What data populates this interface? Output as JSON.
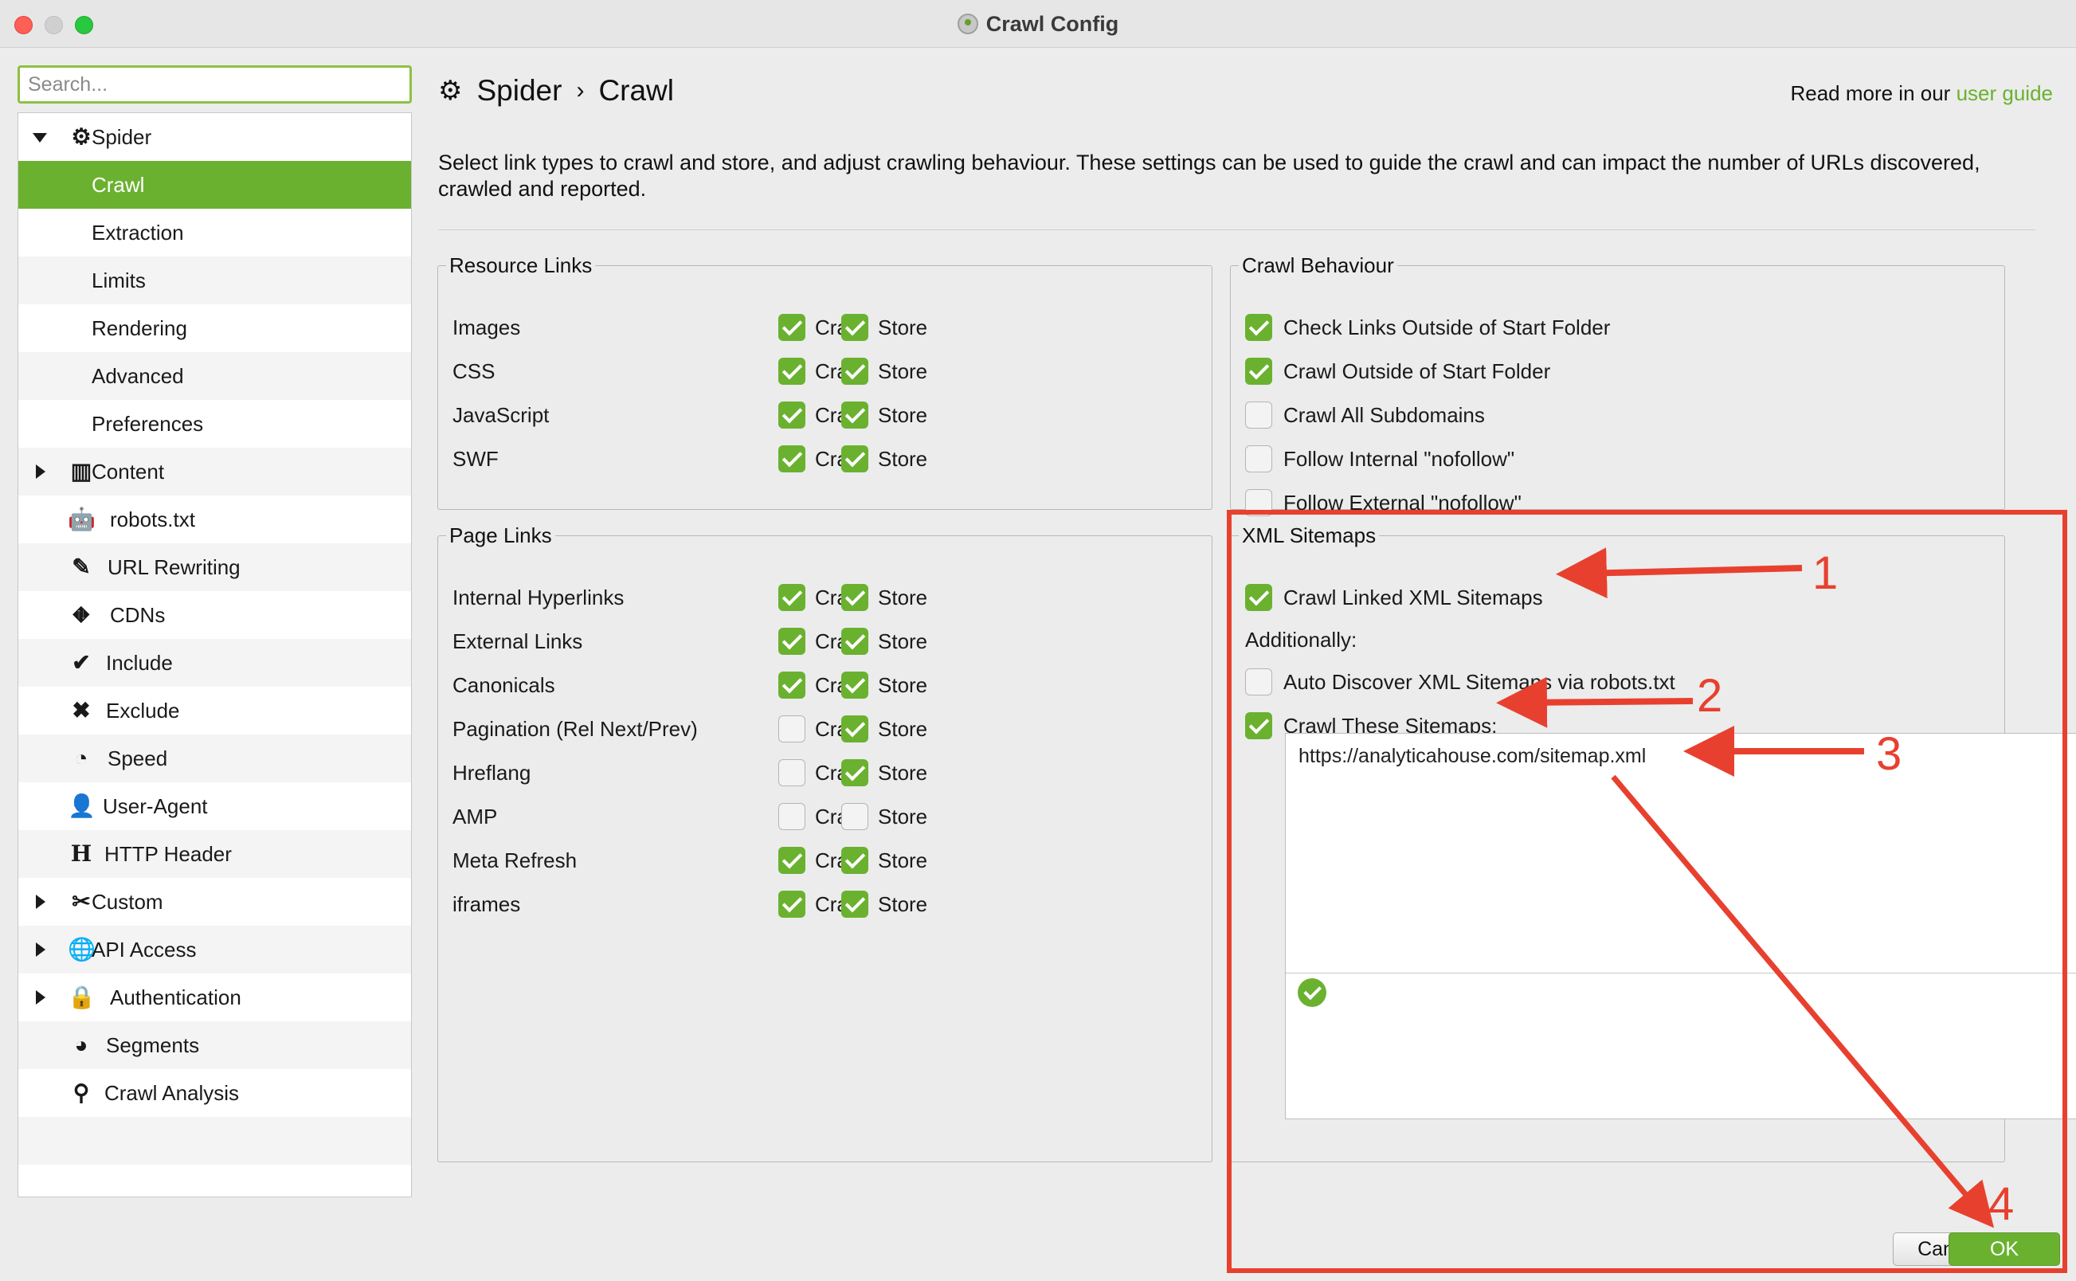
{
  "window": {
    "title": "Crawl Config"
  },
  "search": {
    "placeholder": "Search..."
  },
  "sidebar": {
    "items": [
      {
        "label": "Spider",
        "icon": "gear-icon"
      },
      {
        "label": "Crawl"
      },
      {
        "label": "Extraction"
      },
      {
        "label": "Limits"
      },
      {
        "label": "Rendering"
      },
      {
        "label": "Advanced"
      },
      {
        "label": "Preferences"
      },
      {
        "label": "Content",
        "icon": "columns-icon"
      },
      {
        "label": "robots.txt",
        "icon": "robot-icon"
      },
      {
        "label": "URL Rewriting",
        "icon": "edit-icon"
      },
      {
        "label": "CDNs",
        "icon": "network-icon"
      },
      {
        "label": "Include",
        "icon": "check-circle-icon"
      },
      {
        "label": "Exclude",
        "icon": "x-circle-icon"
      },
      {
        "label": "Speed",
        "icon": "speedometer-icon"
      },
      {
        "label": "User-Agent",
        "icon": "user-icon"
      },
      {
        "label": "HTTP Header",
        "icon": "header-icon"
      },
      {
        "label": "Custom",
        "icon": "tools-icon"
      },
      {
        "label": "API Access",
        "icon": "globe-icon"
      },
      {
        "label": "Authentication",
        "icon": "user-lock-icon"
      },
      {
        "label": "Segments",
        "icon": "pie-icon"
      },
      {
        "label": "Crawl Analysis",
        "icon": "magnifier-icon"
      }
    ]
  },
  "header": {
    "crumb_root": "Spider",
    "crumb_sep": "›",
    "crumb_page": "Crawl",
    "guide_prefix": "Read more in our",
    "guide_link": "user guide",
    "description": "Select link types to crawl and store, and adjust crawling behaviour. These settings can be used to guide the crawl and can impact the number of URLs discovered, crawled and reported."
  },
  "resource_links": {
    "legend": "Resource Links",
    "crawl_label": "Crawl",
    "store_label": "Store",
    "rows": [
      {
        "label": "Images",
        "crawl": true,
        "store": true
      },
      {
        "label": "CSS",
        "crawl": true,
        "store": true
      },
      {
        "label": "JavaScript",
        "crawl": true,
        "store": true
      },
      {
        "label": "SWF",
        "crawl": true,
        "store": true
      }
    ]
  },
  "page_links": {
    "legend": "Page Links",
    "crawl_label": "Crawl",
    "store_label": "Store",
    "rows": [
      {
        "label": "Internal Hyperlinks",
        "crawl": true,
        "store": true
      },
      {
        "label": "External Links",
        "crawl": true,
        "store": true
      },
      {
        "label": "Canonicals",
        "crawl": true,
        "store": true
      },
      {
        "label": "Pagination (Rel Next/Prev)",
        "crawl": false,
        "store": true
      },
      {
        "label": "Hreflang",
        "crawl": false,
        "store": true
      },
      {
        "label": "AMP",
        "crawl": false,
        "store": false
      },
      {
        "label": "Meta Refresh",
        "crawl": true,
        "store": true
      },
      {
        "label": "iframes",
        "crawl": true,
        "store": true
      }
    ]
  },
  "crawl_behaviour": {
    "legend": "Crawl Behaviour",
    "rows": [
      {
        "label": "Check Links Outside of Start Folder",
        "checked": true
      },
      {
        "label": "Crawl Outside of Start Folder",
        "checked": true
      },
      {
        "label": "Crawl All Subdomains",
        "checked": false
      },
      {
        "label": "Follow Internal \"nofollow\"",
        "checked": false
      },
      {
        "label": "Follow External \"nofollow\"",
        "checked": false
      }
    ]
  },
  "xml_sitemaps": {
    "legend": "XML Sitemaps",
    "crawl_linked": {
      "label": "Crawl Linked XML Sitemaps",
      "checked": true
    },
    "additionally": "Additionally:",
    "auto_discover": {
      "label": "Auto Discover XML Sitemaps via robots.txt",
      "checked": false
    },
    "crawl_these": {
      "label": "Crawl These Sitemaps:",
      "checked": true
    },
    "sitemap_urls": "https://analyticahouse.com/sitemap.xml"
  },
  "buttons": {
    "cancel": "Cancel",
    "ok": "OK"
  },
  "annotations": {
    "n1": "1",
    "n2": "2",
    "n3": "3",
    "n4": "4",
    "color": "#e8402f"
  },
  "colors": {
    "accent": "#6bb130",
    "annotation": "#e8402f"
  }
}
